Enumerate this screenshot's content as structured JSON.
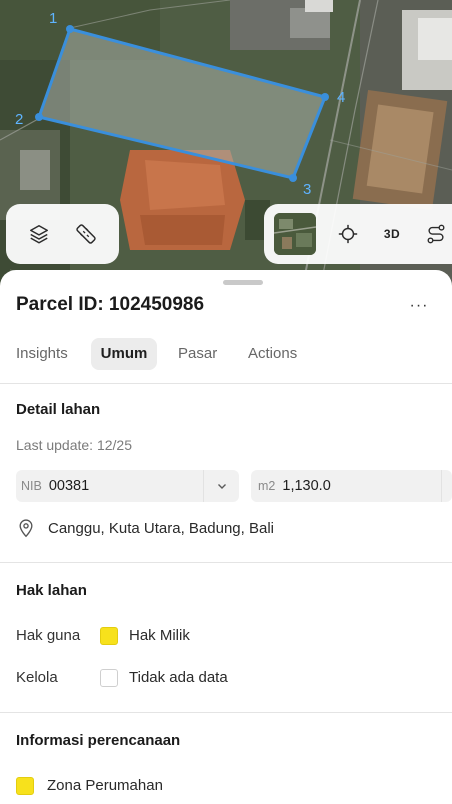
{
  "map": {
    "vertex_labels": [
      "1",
      "2",
      "3",
      "4"
    ],
    "parcel_color": "#3a8fdc",
    "controls": {
      "layers_icon": "layers-icon",
      "measure_icon": "ruler-icon",
      "basemap_icon": "satellite-thumbnail",
      "locate_icon": "crosshair-icon",
      "three_d_label": "3D",
      "route_icon": "route-icon"
    }
  },
  "sheet": {
    "title": "Parcel ID: 102450986",
    "more_label": "···",
    "tabs": [
      {
        "label": "Insights",
        "active": false
      },
      {
        "label": "Umum",
        "active": true
      },
      {
        "label": "Pasar",
        "active": false
      },
      {
        "label": "Actions",
        "active": false
      }
    ],
    "detail": {
      "title": "Detail lahan",
      "last_update": "Last update: 12/25",
      "nib_prefix": "NIB",
      "nib_value": "00381",
      "area_prefix": "m2",
      "area_value": "1,130.0",
      "location": "Canggu, Kuta Utara, Badung, Bali"
    },
    "rights": {
      "title": "Hak lahan",
      "rows": [
        {
          "label": "Hak guna",
          "value": "Hak Milik",
          "swatch": "#f7e11c"
        },
        {
          "label": "Kelola",
          "value": "Tidak ada data",
          "swatch": "#ffffff"
        }
      ]
    },
    "planning": {
      "title": "Informasi perencanaan",
      "zone": "Zona Perumahan",
      "zone_swatch": "#f7e11c"
    }
  },
  "colors": {
    "accent": "#3a8fdc",
    "yellow": "#f7e11c",
    "tab_active_bg": "#ececec"
  }
}
